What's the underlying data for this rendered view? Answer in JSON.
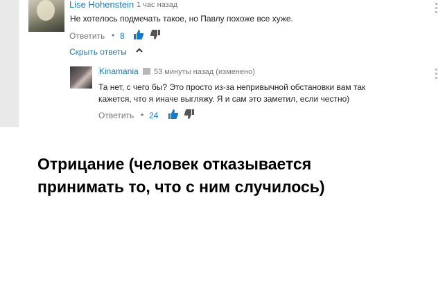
{
  "comments": [
    {
      "author": "Lise Hohenstein",
      "timestamp": "1 час назад",
      "text": "Не хотелось подмечать такое, но Павлу похоже все хуже.",
      "reply_label": "Ответить",
      "likes": "8"
    }
  ],
  "hide_replies_label": "Скрыть ответы",
  "reply": {
    "author": "Kinamania",
    "timestamp": "53 минуты назад (изменено)",
    "text_line1": "Та нет, с чего бы? Это просто из-за непривычной обстановки вам так",
    "text_line2": "кажется, что я иначе выгляжу. Я и сам это заметил, если честно)",
    "reply_label": "Ответить",
    "likes": "24"
  },
  "caption": {
    "line1": "Отрицание (человек отказывается",
    "line2": "принимать то, что с ним случилось)"
  },
  "colors": {
    "link": "#167ac6",
    "meta": "#767676",
    "icon_like": "#167ac6",
    "icon_dislike": "#555555"
  },
  "icons": [
    "thumbs-up-icon",
    "thumbs-down-icon",
    "chevron-up-icon",
    "verified-badge-icon",
    "more-options-icon"
  ]
}
